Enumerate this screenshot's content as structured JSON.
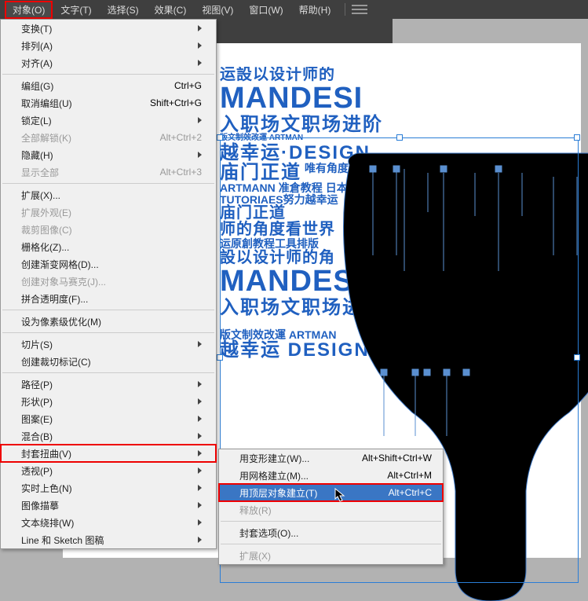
{
  "menubar": {
    "items": [
      {
        "label": "对象(O)",
        "active": true
      },
      {
        "label": "文字(T)"
      },
      {
        "label": "选择(S)"
      },
      {
        "label": "效果(C)"
      },
      {
        "label": "视图(V)"
      },
      {
        "label": "窗口(W)"
      },
      {
        "label": "帮助(H)"
      }
    ]
  },
  "menu": {
    "items": [
      {
        "label": "变换(T)",
        "arrow": true
      },
      {
        "label": "排列(A)",
        "arrow": true
      },
      {
        "label": "对齐(A)",
        "arrow": true
      },
      {
        "sep": true
      },
      {
        "label": "编组(G)",
        "shortcut": "Ctrl+G"
      },
      {
        "label": "取消编组(U)",
        "shortcut": "Shift+Ctrl+G"
      },
      {
        "label": "锁定(L)",
        "arrow": true
      },
      {
        "label": "全部解锁(K)",
        "shortcut": "Alt+Ctrl+2",
        "disabled": true
      },
      {
        "label": "隐藏(H)",
        "arrow": true
      },
      {
        "label": "显示全部",
        "shortcut": "Alt+Ctrl+3",
        "disabled": true
      },
      {
        "sep": true
      },
      {
        "label": "扩展(X)..."
      },
      {
        "label": "扩展外观(E)",
        "disabled": true
      },
      {
        "label": "裁剪图像(C)",
        "disabled": true
      },
      {
        "label": "栅格化(Z)..."
      },
      {
        "label": "创建渐变网格(D)..."
      },
      {
        "label": "创建对象马赛克(J)...",
        "disabled": true
      },
      {
        "label": "拼合透明度(F)..."
      },
      {
        "sep": true
      },
      {
        "label": "设为像素级优化(M)"
      },
      {
        "sep": true
      },
      {
        "label": "切片(S)",
        "arrow": true
      },
      {
        "label": "创建裁切标记(C)"
      },
      {
        "sep": true
      },
      {
        "label": "路径(P)",
        "arrow": true
      },
      {
        "label": "形状(P)",
        "arrow": true
      },
      {
        "label": "图案(E)",
        "arrow": true
      },
      {
        "label": "混合(B)",
        "arrow": true
      },
      {
        "label": "封套扭曲(V)",
        "arrow": true,
        "hl": true
      },
      {
        "label": "透视(P)",
        "arrow": true
      },
      {
        "label": "实时上色(N)",
        "arrow": true
      },
      {
        "label": "图像描摹",
        "arrow": true
      },
      {
        "label": "文本绕排(W)",
        "arrow": true
      },
      {
        "label": "Line 和 Sketch 图稿",
        "arrow": true
      }
    ]
  },
  "submenu": {
    "items": [
      {
        "label": "用变形建立(W)...",
        "shortcut": "Alt+Shift+Ctrl+W"
      },
      {
        "label": "用网格建立(M)...",
        "shortcut": "Alt+Ctrl+M"
      },
      {
        "label": "用顶层对象建立(T)",
        "shortcut": "Alt+Ctrl+C",
        "sel": true,
        "hl": true
      },
      {
        "label": "释放(R)",
        "disabled": true
      },
      {
        "sep": true
      },
      {
        "label": "封套选项(O)..."
      },
      {
        "sep": true
      },
      {
        "label": "扩展(X)",
        "disabled": true
      }
    ]
  },
  "text": {
    "l1": "运設以设计师的",
    "l2": "MANDESI",
    "l3": "入职场文职场进阶",
    "l4": "版文制效改運 ARTMAN",
    "l5": "越幸运·DESIGN",
    "l6": "庙门正道",
    "l7": "唯有角度",
    "l8": "ARTMANN",
    "l9": "准倉教程",
    "l10": "日本設計",
    "l11": "TUTORIAES努力越幸运",
    "l12": "庙门正道",
    "l13": "师的角度看世界",
    "l14": "运原創教程工具排版",
    "l15": "設以设计师的角",
    "l16": "MANDESIGN",
    "l17": "入职场文职场进阶",
    "l18": "庙",
    "l19": "版文制效改運 ARTMAN",
    "l20": "越幸运 DESIGN"
  }
}
